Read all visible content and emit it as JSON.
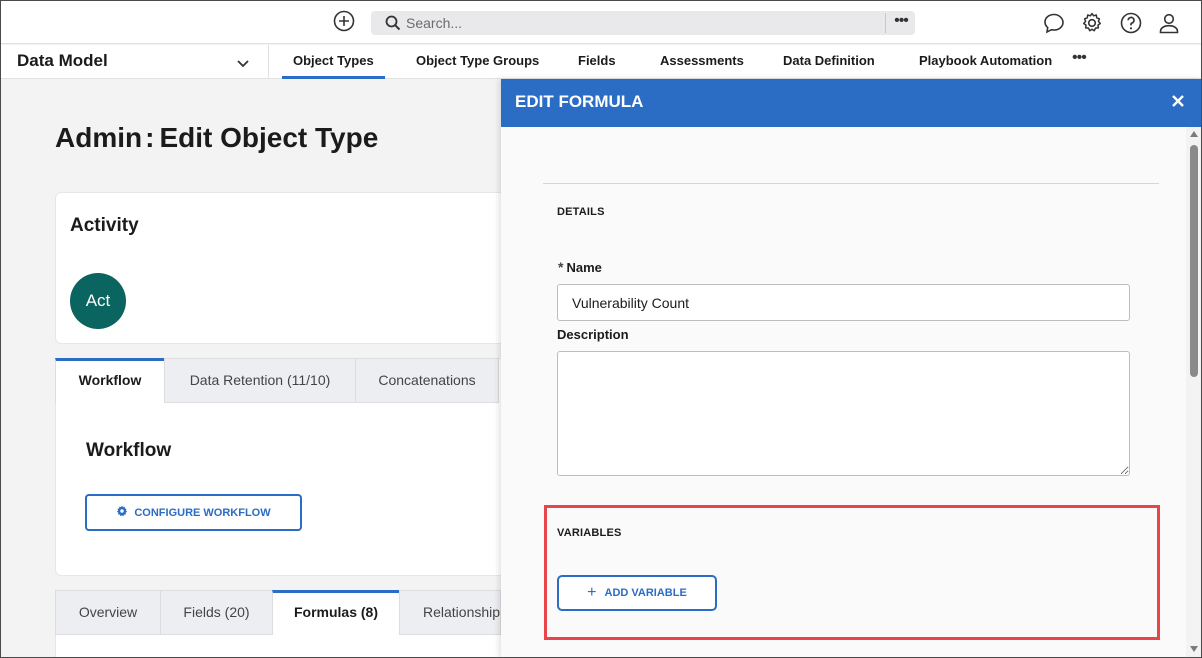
{
  "topbar": {
    "add_icon": "plus-circle-icon",
    "search_placeholder": "Search...",
    "search_more": "•••",
    "icons": [
      "chat-bubble-icon",
      "gear-icon",
      "help-icon",
      "user-icon"
    ]
  },
  "nav": {
    "module": "Data Model",
    "tabs": [
      {
        "label": "Object Types",
        "active": true
      },
      {
        "label": "Object Type Groups"
      },
      {
        "label": "Fields"
      },
      {
        "label": "Assessments"
      },
      {
        "label": "Data Definition"
      },
      {
        "label": "Playbook Automation"
      }
    ],
    "more": "•••"
  },
  "page": {
    "title_prefix": "Admin",
    "title_colon": ":",
    "title_main": "Edit Object Type",
    "card_title": "Activity",
    "avatar": "Act",
    "top_tabs": [
      {
        "label": "Workflow",
        "active": true
      },
      {
        "label": "Data Retention (11/10)"
      },
      {
        "label": "Concatenations"
      }
    ],
    "workflow_heading": "Workflow",
    "configure_button": "CONFIGURE WORKFLOW",
    "bottom_tabs": [
      {
        "label": "Overview"
      },
      {
        "label": "Fields (20)"
      },
      {
        "label": "Formulas (8)",
        "active": true
      },
      {
        "label": "Relationships"
      }
    ]
  },
  "panel": {
    "title": "EDIT FORMULA",
    "details_label": "DETAILS",
    "required_mark": "*",
    "name_label": "Name",
    "name_value": "Vulnerability Count",
    "description_label": "Description",
    "description_value": "",
    "variables_label": "VARIABLES",
    "add_variable_button": "ADD VARIABLE",
    "highlight_color": "#e8454a"
  },
  "colors": {
    "accent": "#2b6cc4",
    "avatar": "#0a6460"
  }
}
